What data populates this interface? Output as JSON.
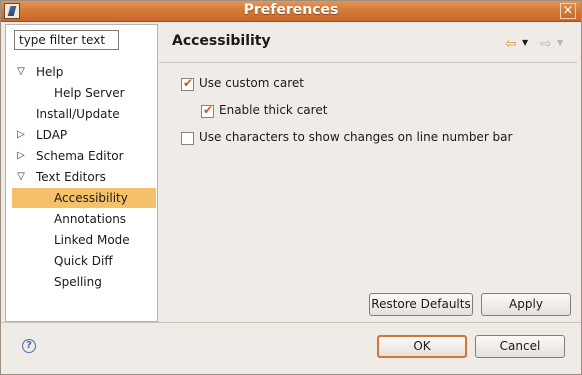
{
  "window": {
    "title": "Preferences"
  },
  "filter": {
    "value": "type filter text"
  },
  "tree": [
    {
      "label": "Help",
      "twisty": "expanded",
      "indent": 0
    },
    {
      "label": "Help Server",
      "twisty": "none",
      "indent": 1
    },
    {
      "label": "Install/Update",
      "twisty": "none",
      "indent": 0
    },
    {
      "label": "LDAP",
      "twisty": "collapsed",
      "indent": 0
    },
    {
      "label": "Schema Editor",
      "twisty": "collapsed",
      "indent": 0
    },
    {
      "label": "Text Editors",
      "twisty": "expanded",
      "indent": 0
    },
    {
      "label": "Accessibility",
      "twisty": "none",
      "indent": 1,
      "selected": true
    },
    {
      "label": "Annotations",
      "twisty": "none",
      "indent": 1
    },
    {
      "label": "Linked Mode",
      "twisty": "none",
      "indent": 1
    },
    {
      "label": "Quick Diff",
      "twisty": "none",
      "indent": 1
    },
    {
      "label": "Spelling",
      "twisty": "none",
      "indent": 1
    }
  ],
  "page": {
    "title": "Accessibility",
    "options": [
      {
        "label": "Use custom caret",
        "checked": true
      },
      {
        "label": "Enable thick caret",
        "checked": true
      },
      {
        "label": "Use characters to show changes on line number bar",
        "checked": false
      }
    ],
    "restore_defaults": "Restore Defaults",
    "apply": "Apply"
  },
  "footer": {
    "ok": "OK",
    "cancel": "Cancel"
  },
  "colors": {
    "titlebar": "#d27636",
    "selection": "#f5c26b",
    "check": "#d4581b"
  }
}
